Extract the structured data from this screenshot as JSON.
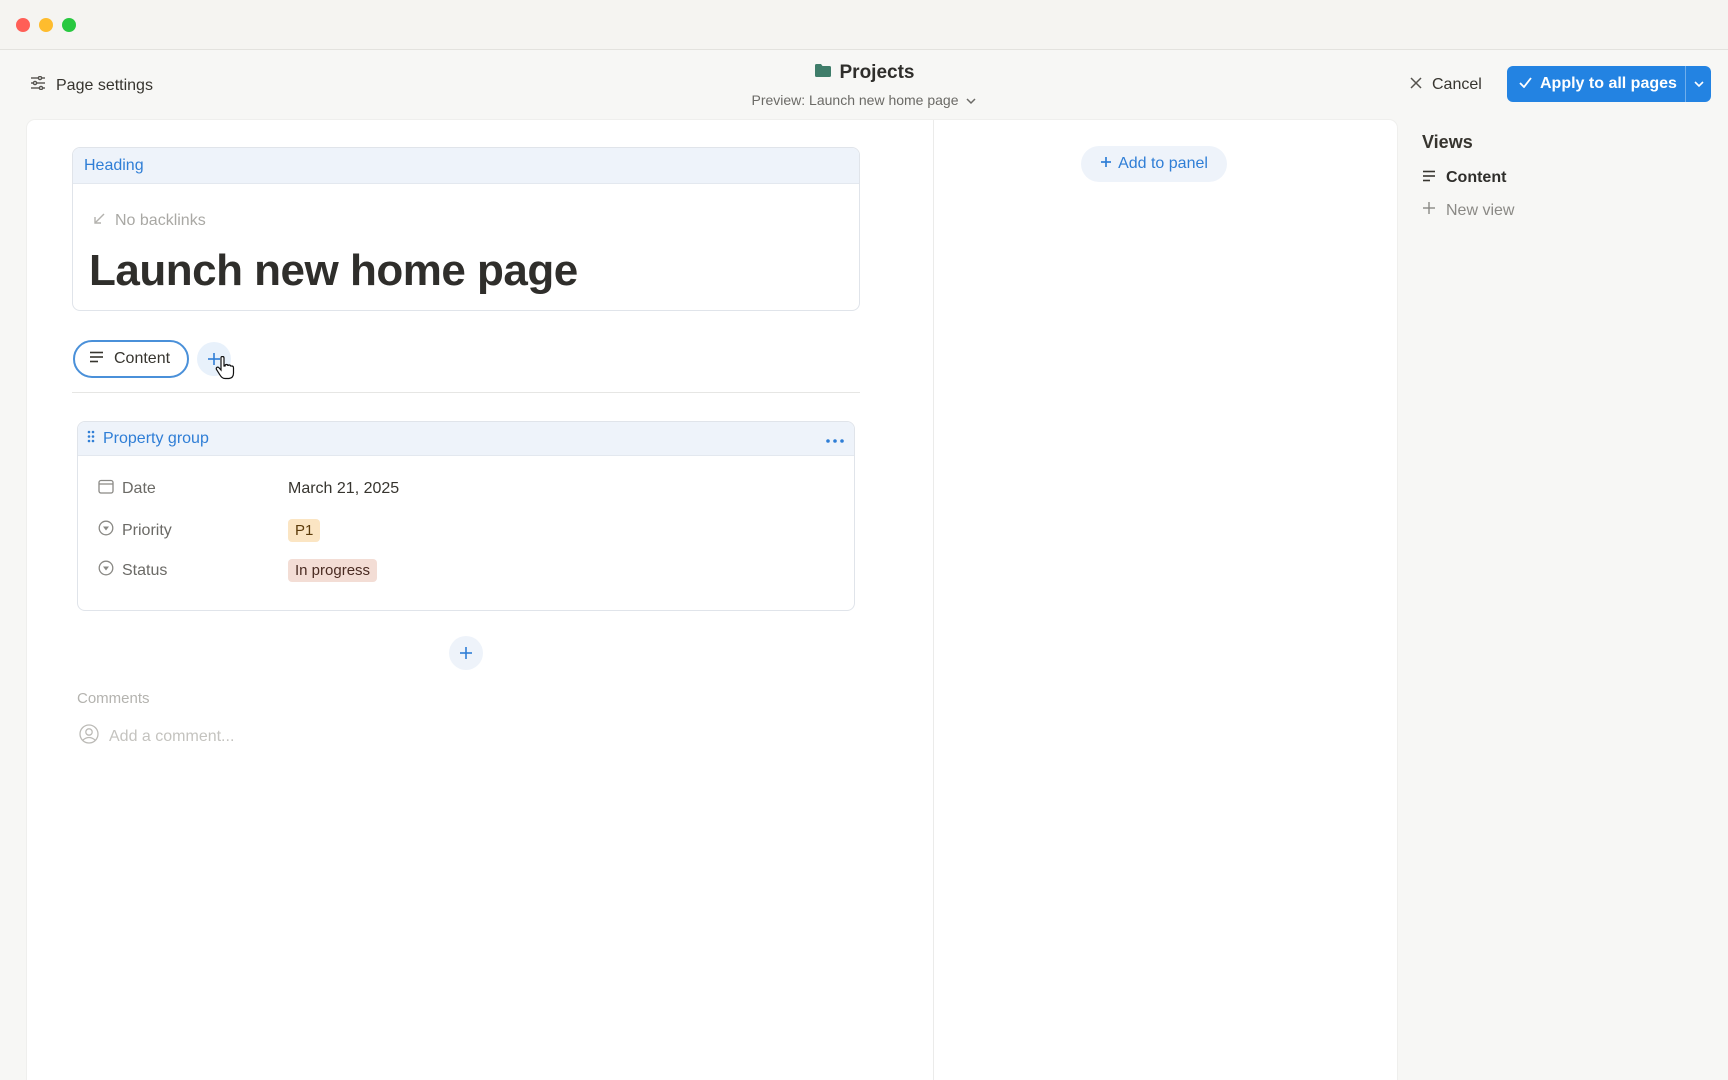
{
  "header": {
    "page_settings_label": "Page settings",
    "title": "Projects",
    "preview_label": "Preview: Launch new home page",
    "cancel_label": "Cancel",
    "apply_label": "Apply to all pages"
  },
  "heading_block": {
    "label": "Heading",
    "backlinks_text": "No backlinks",
    "page_title": "Launch new home page"
  },
  "tabs": [
    {
      "label": "Content",
      "active": true
    }
  ],
  "property_group": {
    "label": "Property group",
    "properties": [
      {
        "name": "Date",
        "icon": "calendar-icon",
        "value": "March 21, 2025"
      },
      {
        "name": "Priority",
        "icon": "select-icon",
        "value": "P1"
      },
      {
        "name": "Status",
        "icon": "select-icon",
        "value": "In progress"
      }
    ]
  },
  "comments": {
    "label": "Comments",
    "placeholder": "Add a comment..."
  },
  "side_panel": {
    "add_label": "Add to panel"
  },
  "views": {
    "title": "Views",
    "items": [
      {
        "label": "Content"
      }
    ],
    "new_view_label": "New view"
  },
  "colors": {
    "accent": "#2383e2",
    "tag_p1_bg": "#fbe5c3",
    "tag_in_progress_bg": "#f3ddd5"
  }
}
